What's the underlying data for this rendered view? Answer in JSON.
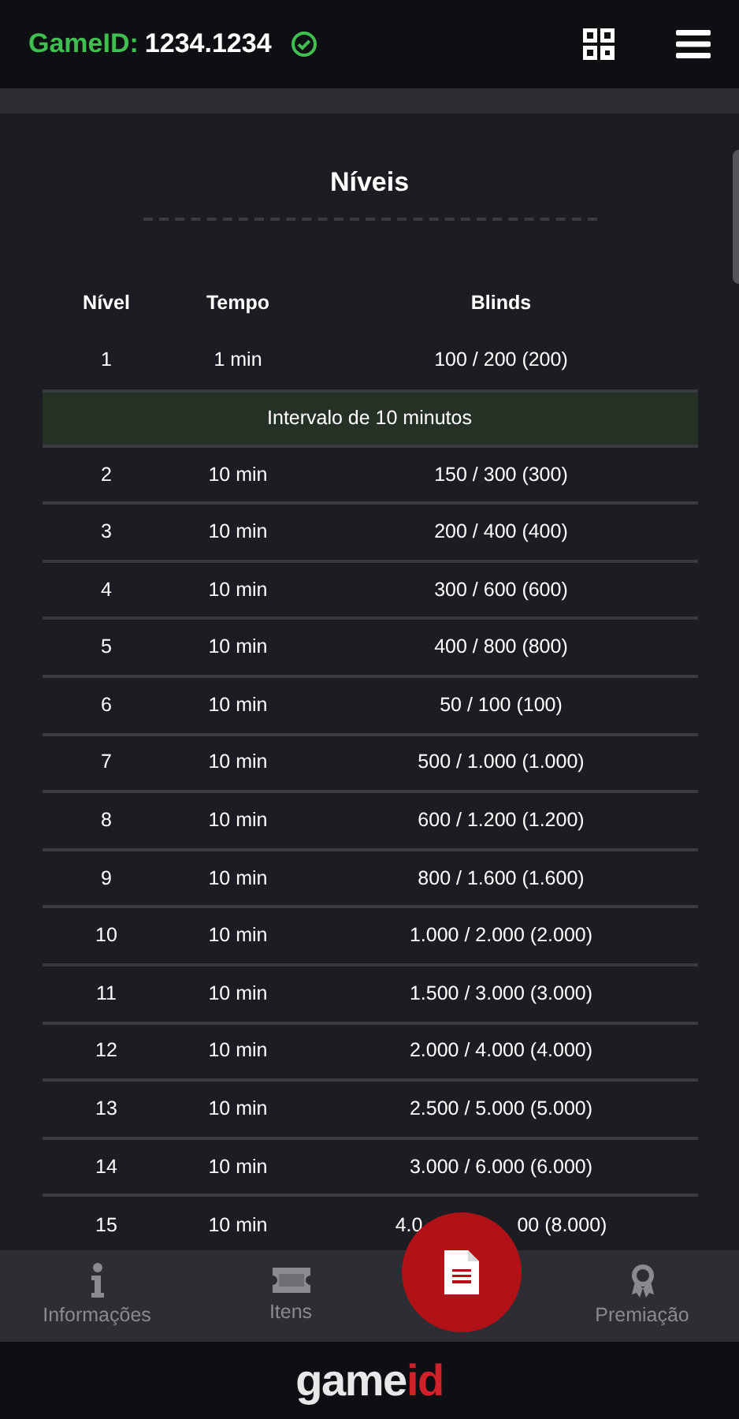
{
  "header": {
    "label": "GameID:",
    "game_id": "1234.1234",
    "verified": true
  },
  "title": "Níveis",
  "table": {
    "columns": [
      "Nível",
      "Tempo",
      "Blinds"
    ],
    "rows": [
      {
        "kind": "level",
        "level": "1",
        "time": "1 min",
        "blinds": "100 / 200 (200)"
      },
      {
        "kind": "break",
        "text": "Intervalo de 10 minutos"
      },
      {
        "kind": "level",
        "level": "2",
        "time": "10 min",
        "blinds": "150 / 300 (300)"
      },
      {
        "kind": "level",
        "level": "3",
        "time": "10 min",
        "blinds": "200 / 400 (400)"
      },
      {
        "kind": "level",
        "level": "4",
        "time": "10 min",
        "blinds": "300 / 600 (600)"
      },
      {
        "kind": "level",
        "level": "5",
        "time": "10 min",
        "blinds": "400 / 800 (800)"
      },
      {
        "kind": "level",
        "level": "6",
        "time": "10 min",
        "blinds": "50 / 100 (100)"
      },
      {
        "kind": "level",
        "level": "7",
        "time": "10 min",
        "blinds": "500 / 1.000 (1.000)"
      },
      {
        "kind": "level",
        "level": "8",
        "time": "10 min",
        "blinds": "600 / 1.200 (1.200)"
      },
      {
        "kind": "level",
        "level": "9",
        "time": "10 min",
        "blinds": "800 / 1.600 (1.600)"
      },
      {
        "kind": "level",
        "level": "10",
        "time": "10 min",
        "blinds": "1.000 / 2.000 (2.000)"
      },
      {
        "kind": "level",
        "level": "11",
        "time": "10 min",
        "blinds": "1.500 / 3.000 (3.000)"
      },
      {
        "kind": "level",
        "level": "12",
        "time": "10 min",
        "blinds": "2.000 / 4.000 (4.000)"
      },
      {
        "kind": "level",
        "level": "13",
        "time": "10 min",
        "blinds": "2.500 / 5.000 (5.000)"
      },
      {
        "kind": "level",
        "level": "14",
        "time": "10 min",
        "blinds": "3.000 / 6.000 (6.000)"
      },
      {
        "kind": "partial",
        "level": "15",
        "time": "10 min",
        "blinds_parts": [
          "4.0",
          "00 (8.000)"
        ]
      }
    ]
  },
  "bottom_nav": [
    {
      "kind": "info",
      "label": "Informações"
    },
    {
      "kind": "ticket",
      "label": "Itens"
    },
    {
      "kind": "fab"
    },
    {
      "kind": "award",
      "label": "Premiação"
    }
  ],
  "footer": {
    "logo_parts": [
      "game",
      "id"
    ]
  }
}
